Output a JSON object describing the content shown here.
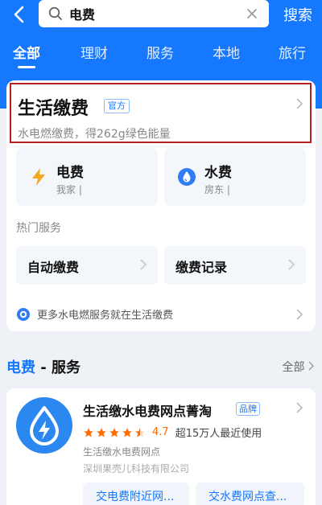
{
  "search": {
    "query": "电费",
    "button_label": "搜索"
  },
  "tabs": [
    "全部",
    "理财",
    "服务",
    "本地",
    "旅行"
  ],
  "life_payment": {
    "title": "生活缴费",
    "official_badge": "官方",
    "subtitle": "水电燃缴费，得262g绿色能量"
  },
  "services": [
    {
      "name": "电费",
      "sub": "我家 |",
      "icon": "lightning-icon",
      "color": "#f5a623"
    },
    {
      "name": "水费",
      "sub": "房东 |",
      "icon": "water-drop-icon",
      "color": "#2f7cf6"
    }
  ],
  "hot_label": "热门服务",
  "hot_options": [
    "自动缴费",
    "缴费记录"
  ],
  "more_text": "更多水电燃服务就在生活缴费",
  "section": {
    "keyword": "电费",
    "rest": " - 服务",
    "all_label": "全部"
  },
  "app": {
    "name": "生活缴水电费网点菁淘",
    "brand_badge": "品牌",
    "rating": "4.7",
    "stars": 4.5,
    "users": "超15万人最近使用",
    "desc": "生活缴水电费网点",
    "company": "深圳果壳儿科技有限公司",
    "chips": [
      "交电费附近网...",
      "交水费网点查..."
    ]
  },
  "colors": {
    "primary": "#1677ff",
    "highlight_border": "#b22222",
    "star": "#ff6a00"
  }
}
